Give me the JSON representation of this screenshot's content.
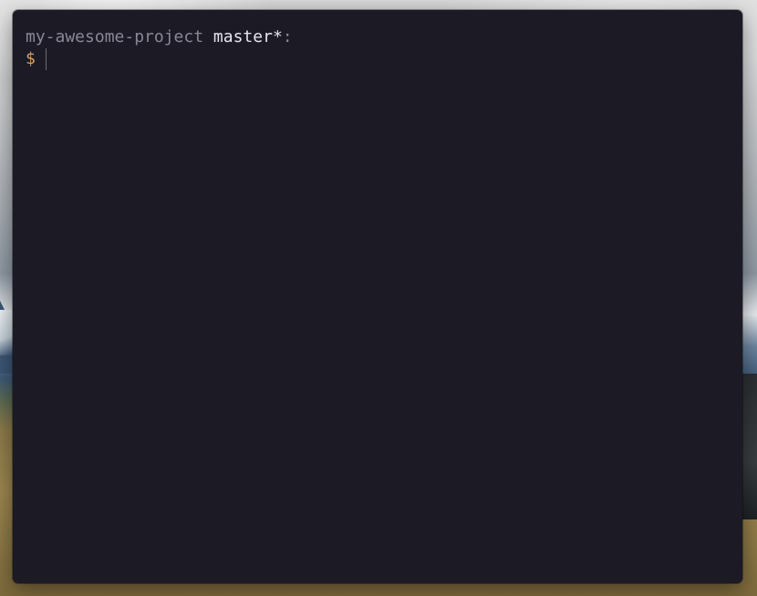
{
  "terminal": {
    "directory": "my-awesome-project",
    "branch": "master*",
    "separator": ":",
    "prompt_symbol": "$",
    "input_value": ""
  },
  "colors": {
    "background": "#1b1a25",
    "directory": "#8a8896",
    "branch": "#e6e6ee",
    "prompt": "#d8a267"
  }
}
